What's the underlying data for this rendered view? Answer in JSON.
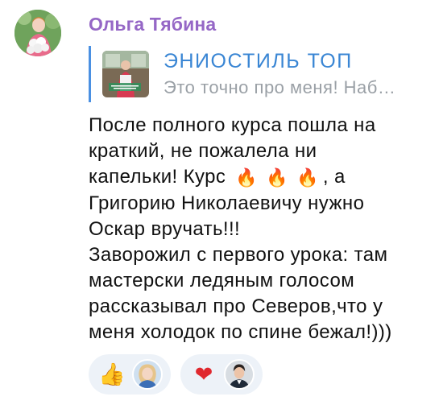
{
  "message": {
    "sender_name": "Ольга Тябина",
    "reply": {
      "title": "ЭНИОСТИЛЬ ТОП",
      "preview": "Это точно про меня!   Наб…"
    },
    "text_lines": [
      "После полного курса пошла на",
      "краткий, не пожалела ни",
      "капельки! Курс",
      "Григорию Николаевичу нужно",
      "Оскар вручать!!!",
      "Заворожил с первого урока: там",
      "мастерски ледяным голосом",
      "рассказывал про Северов,что у",
      "меня холодок по спине бежал!)))"
    ],
    "line3_suffix": ", а",
    "fire_emoji": "🔥",
    "fire_count": 3
  },
  "reactions": [
    {
      "emoji": "👍",
      "icon": "thumbs-up-icon"
    },
    {
      "emoji": "❤",
      "icon": "heart-icon"
    }
  ],
  "colors": {
    "sender": "#9567c6",
    "reply_bar": "#4a90e2",
    "reply_title": "#3a86d4",
    "reply_preview": "#9aa0a6",
    "reaction_bg": "#edf2f8"
  }
}
